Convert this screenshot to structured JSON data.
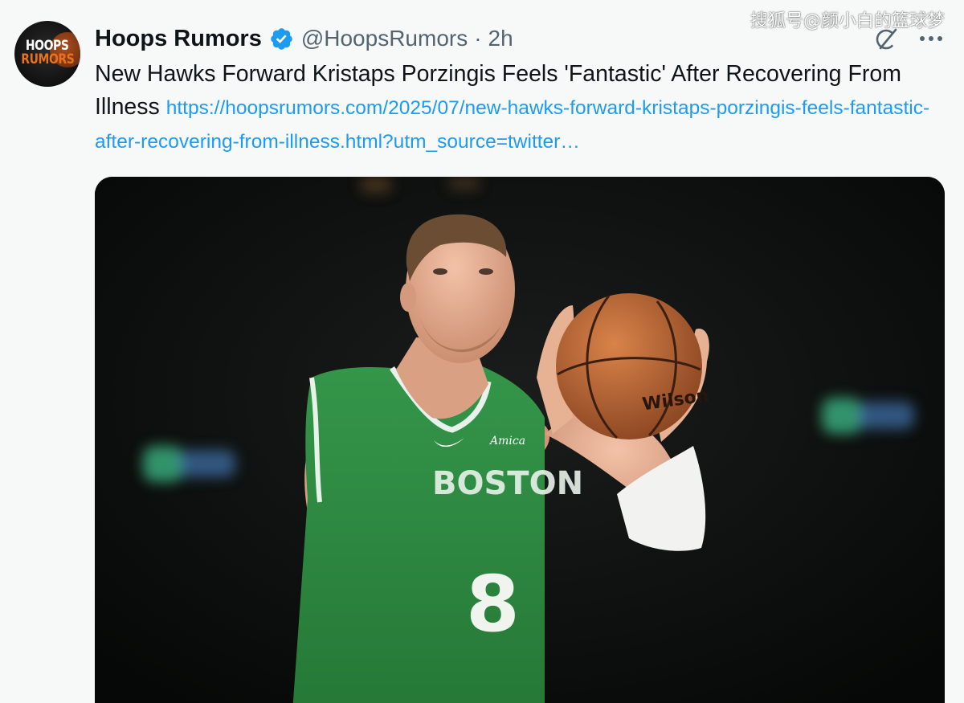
{
  "author": {
    "avatar_line1": "HOOPS",
    "avatar_line2": "RUMORS",
    "display_name": "Hoops Rumors",
    "handle": "@HoopsRumors",
    "separator": "·",
    "timestamp": "2h"
  },
  "watermark": "搜狐号@颜小白的篮球梦",
  "tweet": {
    "text": "New Hawks Forward Kristaps Porzingis Feels 'Fantastic' After Recovering From Illness",
    "link": "https://hoopsrumors.com/2025/07/new-hawks-forward-kristaps-porzingis-feels-fantastic-after-recovering-from-illness.html?utm_source=twitter…"
  },
  "media": {
    "jersey_text": "BOSTON",
    "jersey_number": "8",
    "sponsor": "Amica",
    "ball_brand": "Wilson"
  },
  "colors": {
    "link": "#1d9bf0",
    "verified": "#1d9bf0",
    "secondary_text": "#536471",
    "jersey_green": "#2f8a3f"
  },
  "icons": [
    "verified-badge-icon",
    "grok-icon",
    "more-options-icon"
  ]
}
